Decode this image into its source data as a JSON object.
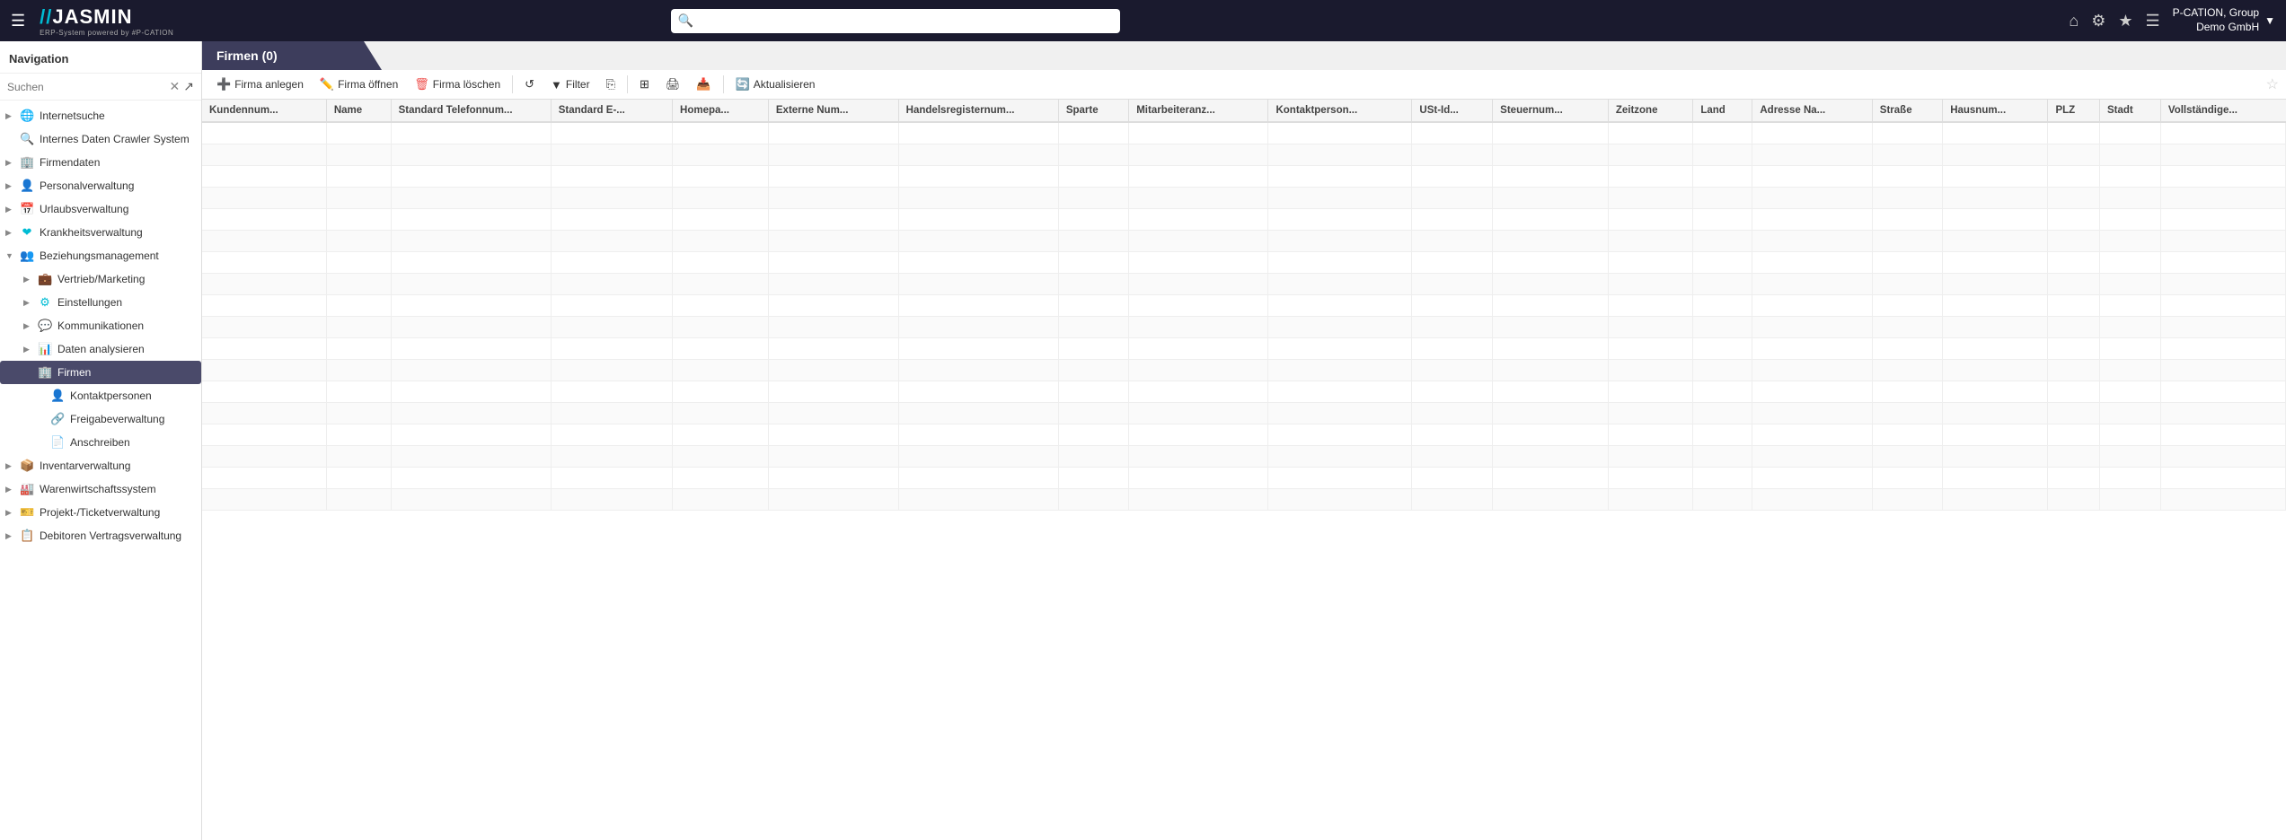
{
  "topbar": {
    "hamburger": "☰",
    "logo_slashes": "//",
    "logo_name": "JASMIN",
    "logo_sub": "ERP-System powered by #P-CATION",
    "search_placeholder": "",
    "icons": {
      "home": "⌂",
      "settings": "⚙",
      "star": "★",
      "menu": "☰"
    },
    "user_line1": "P-CATION, Group",
    "user_line2": "Demo GmbH",
    "user_arrow": "▼"
  },
  "navigation": {
    "header": "Navigation",
    "search_placeholder": "Suchen",
    "items": [
      {
        "id": "internetsuche",
        "label": "Internetsuche",
        "icon": "🌐",
        "arrow": "▶",
        "indent": 0
      },
      {
        "id": "daten-crawler",
        "label": "Internes Daten Crawler System",
        "icon": "🔍",
        "arrow": "",
        "indent": 0
      },
      {
        "id": "firmendaten",
        "label": "Firmendaten",
        "icon": "🏢",
        "arrow": "▶",
        "indent": 0
      },
      {
        "id": "personalverwaltung",
        "label": "Personalverwaltung",
        "icon": "👤",
        "arrow": "▶",
        "indent": 0
      },
      {
        "id": "urlaubsverwaltung",
        "label": "Urlaubsverwaltung",
        "icon": "📅",
        "arrow": "▶",
        "indent": 0
      },
      {
        "id": "krankheitsverwaltung",
        "label": "Krankheitsverwaltung",
        "icon": "❤",
        "arrow": "▶",
        "indent": 0
      },
      {
        "id": "beziehungsmanagement",
        "label": "Beziehungsmanagement",
        "icon": "👥",
        "arrow": "▼",
        "indent": 0
      },
      {
        "id": "vertrieb",
        "label": "Vertrieb/Marketing",
        "icon": "💼",
        "arrow": "▶",
        "indent": 1
      },
      {
        "id": "einstellungen",
        "label": "Einstellungen",
        "icon": "⚙",
        "arrow": "▶",
        "indent": 1
      },
      {
        "id": "kommunikationen",
        "label": "Kommunikationen",
        "icon": "💬",
        "arrow": "▶",
        "indent": 1
      },
      {
        "id": "daten-analysieren",
        "label": "Daten analysieren",
        "icon": "📊",
        "arrow": "▶",
        "indent": 1
      },
      {
        "id": "firmen",
        "label": "Firmen",
        "icon": "🏢",
        "arrow": "",
        "indent": 1,
        "active": true
      },
      {
        "id": "kontaktpersonen",
        "label": "Kontaktpersonen",
        "icon": "👤",
        "arrow": "",
        "indent": 2
      },
      {
        "id": "freigabeverwaltung",
        "label": "Freigabeverwaltung",
        "icon": "🔗",
        "arrow": "",
        "indent": 2
      },
      {
        "id": "anschreiben",
        "label": "Anschreiben",
        "icon": "📄",
        "arrow": "",
        "indent": 2
      },
      {
        "id": "inventarverwaltung",
        "label": "Inventarverwaltung",
        "icon": "📦",
        "arrow": "▶",
        "indent": 0
      },
      {
        "id": "warenwirtschaft",
        "label": "Warenwirtschaftssystem",
        "icon": "🏭",
        "arrow": "▶",
        "indent": 0
      },
      {
        "id": "projekt-ticketverwaltung",
        "label": "Projekt-/Ticketverwaltung",
        "icon": "🎫",
        "arrow": "▶",
        "indent": 0
      },
      {
        "id": "debitoren",
        "label": "Debitoren Vertragsverwaltung",
        "icon": "📋",
        "arrow": "▶",
        "indent": 0
      }
    ]
  },
  "content": {
    "title": "Firmen (0)",
    "toolbar": {
      "add_label": "Firma anlegen",
      "edit_label": "Firma öffnen",
      "delete_label": "Firma löschen",
      "filter_label": "Filter",
      "refresh_label": "Aktualisieren"
    },
    "table": {
      "columns": [
        "Kundennum...",
        "Name",
        "Standard Telefonnum...",
        "Standard E-...",
        "Homepa...",
        "Externe Num...",
        "Handelsregisternum...",
        "Sparte",
        "Mitarbeiteranz...",
        "Kontaktperson...",
        "USt-Id...",
        "Steuernum...",
        "Zeitzone",
        "Land",
        "Adresse Na...",
        "Straße",
        "Hausnum...",
        "PLZ",
        "Stadt",
        "Vollständige..."
      ],
      "rows": []
    }
  }
}
